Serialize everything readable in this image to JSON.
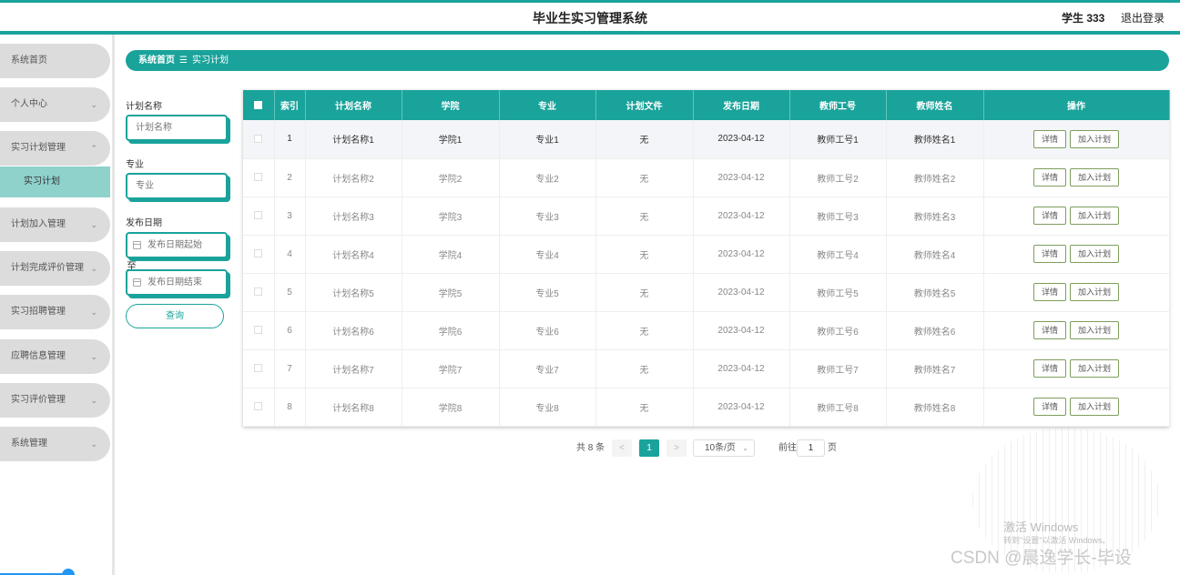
{
  "header": {
    "title": "毕业生实习管理系统",
    "user": "学生 333",
    "logout": "退出登录"
  },
  "sidebar": {
    "items": [
      {
        "label": "系统首页",
        "chevron": false
      },
      {
        "label": "个人中心",
        "chevron": true
      },
      {
        "label": "实习计划管理",
        "chevron": true,
        "expanded": true
      },
      {
        "label": "计划加入管理",
        "chevron": true
      },
      {
        "label": "计划完成评价管理",
        "chevron": true
      },
      {
        "label": "实习招聘管理",
        "chevron": true
      },
      {
        "label": "应聘信息管理",
        "chevron": true
      },
      {
        "label": "实习评价管理",
        "chevron": true
      },
      {
        "label": "系统管理",
        "chevron": true
      }
    ],
    "sub_item": "实习计划"
  },
  "breadcrumb": {
    "home": "系统首页",
    "sep": "☰",
    "current": "实习计划"
  },
  "filters": {
    "name_label": "计划名称",
    "name_placeholder": "计划名称",
    "major_label": "专业",
    "major_placeholder": "专业",
    "date_label": "发布日期",
    "date_start_placeholder": "发布日期起始",
    "to_label": "至",
    "date_end_placeholder": "发布日期结束",
    "query": "查询"
  },
  "table": {
    "headers": [
      "索引",
      "计划名称",
      "学院",
      "专业",
      "计划文件",
      "发布日期",
      "教师工号",
      "教师姓名",
      "操作"
    ],
    "detail_btn": "详情",
    "join_btn": "加入计划",
    "rows": [
      [
        "1",
        "计划名称1",
        "学院1",
        "专业1",
        "无",
        "2023-04-12",
        "教师工号1",
        "教师姓名1"
      ],
      [
        "2",
        "计划名称2",
        "学院2",
        "专业2",
        "无",
        "2023-04-12",
        "教师工号2",
        "教师姓名2"
      ],
      [
        "3",
        "计划名称3",
        "学院3",
        "专业3",
        "无",
        "2023-04-12",
        "教师工号3",
        "教师姓名3"
      ],
      [
        "4",
        "计划名称4",
        "学院4",
        "专业4",
        "无",
        "2023-04-12",
        "教师工号4",
        "教师姓名4"
      ],
      [
        "5",
        "计划名称5",
        "学院5",
        "专业5",
        "无",
        "2023-04-12",
        "教师工号5",
        "教师姓名5"
      ],
      [
        "6",
        "计划名称6",
        "学院6",
        "专业6",
        "无",
        "2023-04-12",
        "教师工号6",
        "教师姓名6"
      ],
      [
        "7",
        "计划名称7",
        "学院7",
        "专业7",
        "无",
        "2023-04-12",
        "教师工号7",
        "教师姓名7"
      ],
      [
        "8",
        "计划名称8",
        "学院8",
        "专业8",
        "无",
        "2023-04-12",
        "教师工号8",
        "教师姓名8"
      ]
    ]
  },
  "pagination": {
    "total": "共 8 条",
    "prev": "<",
    "page": "1",
    "next": ">",
    "page_size": "10条/页",
    "goto_label": "前往",
    "goto_value": "1",
    "page_unit": "页"
  },
  "watermark": {
    "activate": "激活 Windows",
    "activate_hint": "转到\"设置\"以激活 Windows。",
    "csdn": "CSDN @晨逸学长-毕设"
  },
  "colors": {
    "accent": "#1aa39b",
    "sub_active": "#8fd2cc",
    "nav_bg": "#dcdcdc"
  }
}
